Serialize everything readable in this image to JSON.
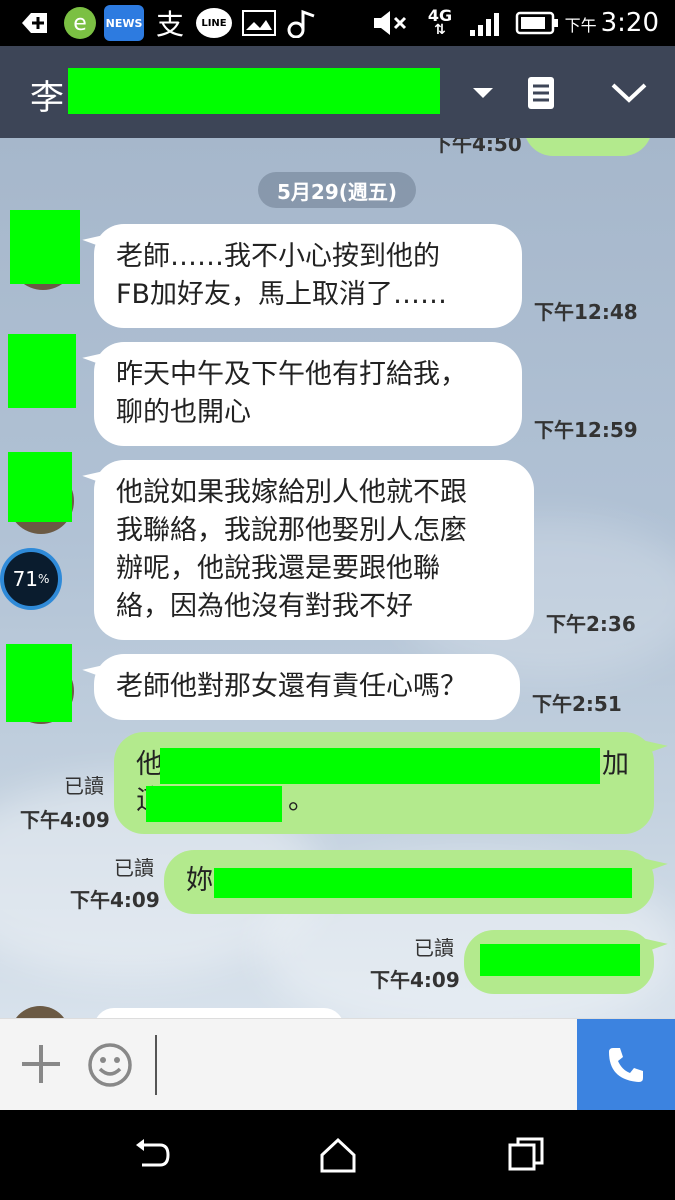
{
  "status_bar": {
    "time_prefix": "下午",
    "time": "3:20",
    "news_label": "NEWS",
    "line_label": "LINE",
    "alipay_glyph": "支",
    "network": "4G",
    "icons": [
      "add-icon",
      "browser-icon",
      "news-app-icon",
      "alipay-icon",
      "line-app-icon",
      "gallery-icon",
      "music-icon",
      "mute-icon",
      "signal-icon",
      "battery-icon"
    ]
  },
  "header": {
    "title_visible": "李",
    "dropdown_icon": "chevron-down-icon",
    "notes_icon": "notes-icon",
    "collapse_icon": "chevron-down-icon"
  },
  "chat": {
    "top_partial_time": "下午4:50",
    "date_label": "5月29(週五)",
    "incoming": [
      {
        "lines": [
          "老師……我不小心按到他的",
          "FB加好友，馬上取消了……"
        ],
        "time": "下午12:48"
      },
      {
        "lines": [
          "昨天中午及下午他有打給我，",
          "聊的也開心"
        ],
        "time": "下午12:59"
      },
      {
        "lines": [
          "他說如果我嫁給別人他就不跟",
          "我聯絡，我說那他娶別人怎麼",
          "辦呢，他說我還是要跟他聯",
          "絡，因為他沒有對我不好"
        ],
        "time": "下午2:36"
      },
      {
        "lines": [
          "老師他對那女還有責任心嗎？"
        ],
        "time": "下午2:51"
      }
    ],
    "outgoing": [
      {
        "read": "已讀",
        "time": "下午4:09",
        "line1_start": "他",
        "line1_end": "加",
        "line2_start": "這",
        "line2_end": "。"
      },
      {
        "read": "已讀",
        "time": "下午4:09",
        "line1_start": "妳"
      },
      {
        "read": "已讀",
        "time": "下午4:09"
      }
    ],
    "battery_widget": {
      "value": "71",
      "unit": "%"
    }
  },
  "input_bar": {
    "placeholder": "",
    "plus_icon": "plus-icon",
    "emoji_icon": "emoji-icon",
    "call_icon": "phone-icon"
  },
  "colors": {
    "header_bg": "#3d4557",
    "outgoing_bubble": "#b3ea8d",
    "incoming_bubble": "#ffffff",
    "redaction": "#00ff00",
    "call_button": "#3c83e0"
  }
}
